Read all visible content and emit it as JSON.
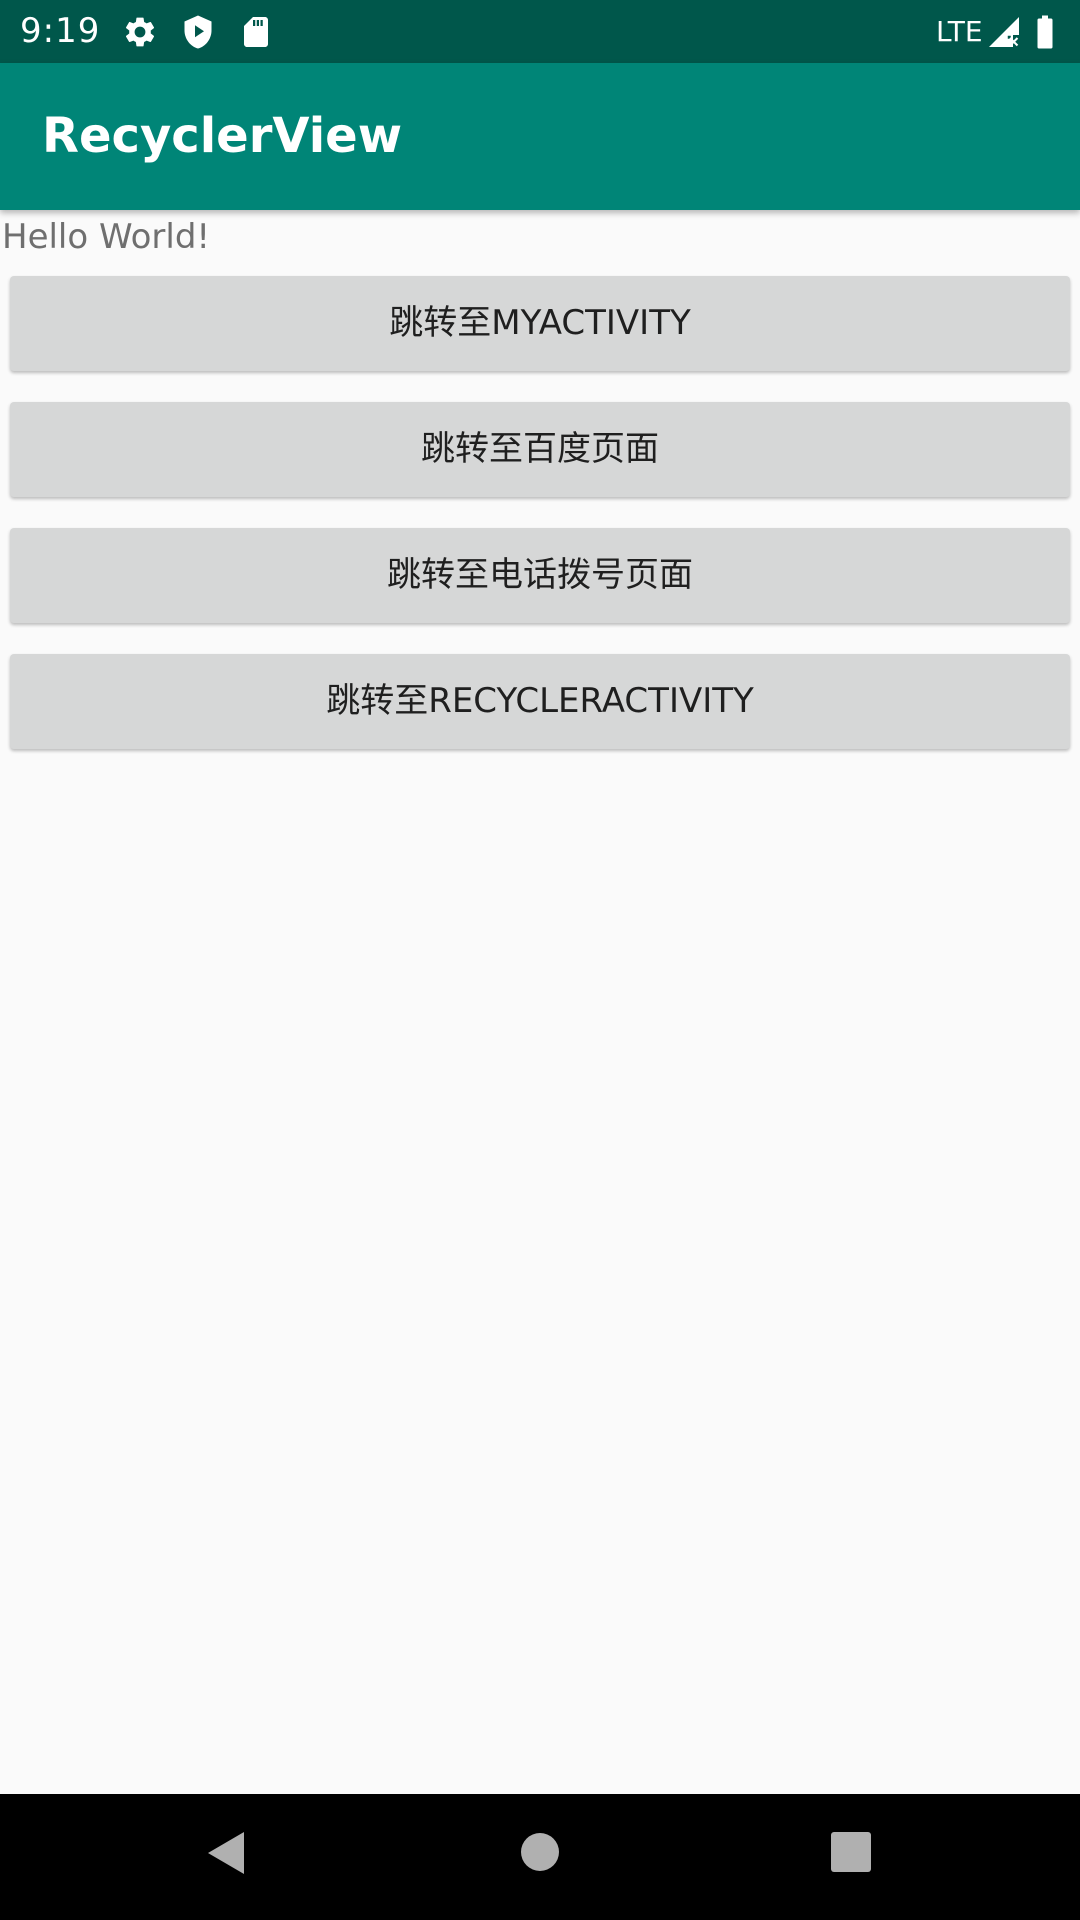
{
  "status_bar": {
    "time": "9:19",
    "network": "LTE",
    "icons": [
      "settings-icon",
      "shield-play-icon",
      "sd-card-icon",
      "signal-icon",
      "battery-icon"
    ],
    "background_color": "#00574b"
  },
  "app_bar": {
    "title": "RecyclerView",
    "background_color": "#008577"
  },
  "main": {
    "hello_text": "Hello World!",
    "buttons": [
      {
        "label": "跳转至MYACTIVITY"
      },
      {
        "label": "跳转至百度页面"
      },
      {
        "label": "跳转至电话拨号页面"
      },
      {
        "label": "跳转至RECYCLERACTIVITY"
      }
    ]
  },
  "nav_bar": {
    "buttons": [
      "back-icon",
      "home-icon",
      "recents-icon"
    ]
  }
}
